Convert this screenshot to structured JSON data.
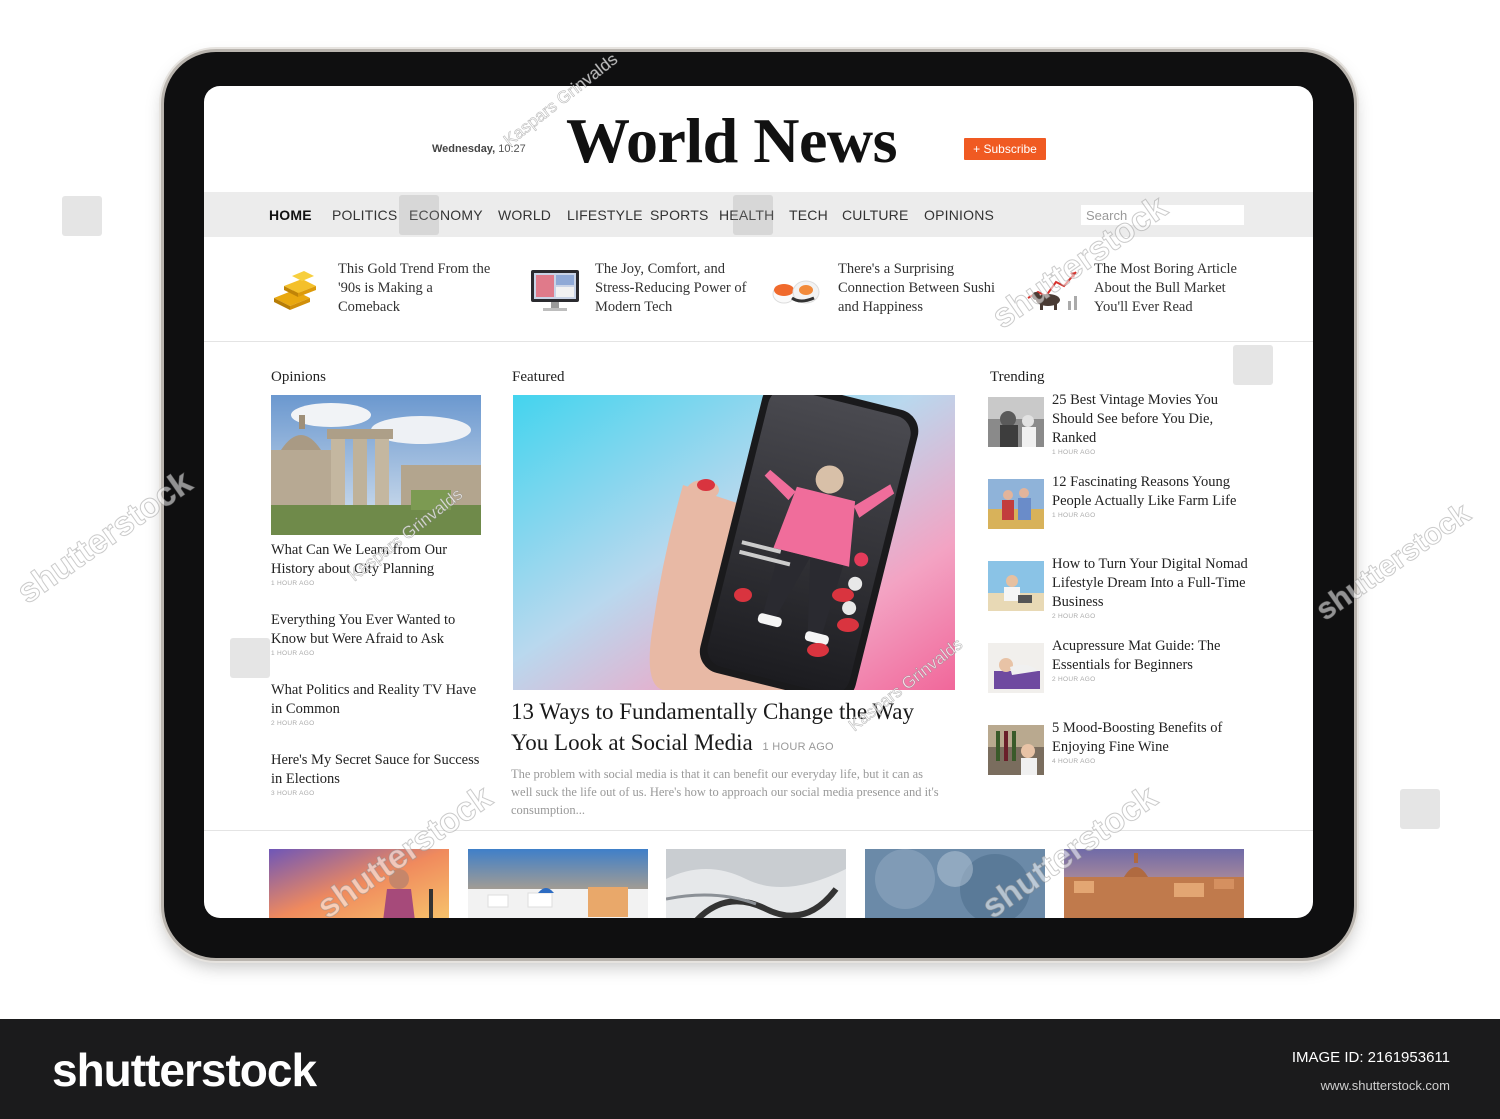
{
  "masthead": {
    "day": "Wednesday,",
    "time": "10:27",
    "logo": "World News",
    "subscribe_label": "+ Subscribe"
  },
  "nav": {
    "items": [
      "HOME",
      "POLITICS",
      "ECONOMY",
      "WORLD",
      "LIFESTYLE",
      "SPORTS",
      "HEALTH",
      "TECH",
      "CULTURE",
      "OPINIONS"
    ],
    "active": "HOME",
    "search_placeholder": "Search"
  },
  "strip": [
    {
      "title": "This Gold Trend From the '90s is Making a Comeback",
      "icon": "gold-bars"
    },
    {
      "title": "The Joy, Comfort, and Stress-Reducing Power of Modern Tech",
      "icon": "monitor"
    },
    {
      "title": "There's a Surprising Connection Between Sushi and Happiness",
      "icon": "sushi"
    },
    {
      "title": "The Most Boring Article About the Bull Market You'll Ever Read",
      "icon": "bull-chart"
    }
  ],
  "sections": {
    "opinions": "Opinions",
    "featured": "Featured",
    "trending": "Trending"
  },
  "opinions": [
    {
      "title": "What Can We Learn from Our History about City Planning",
      "meta": "1 HOUR AGO"
    },
    {
      "title": "Everything You Ever Wanted to Know but Were Afraid to Ask",
      "meta": "1 HOUR AGO"
    },
    {
      "title": "What Politics and Reality TV Have in Common",
      "meta": "2 HOUR AGO"
    },
    {
      "title": "Here's My Secret Sauce for Success in Elections",
      "meta": "3 HOUR AGO"
    }
  ],
  "featured": {
    "title": "13 Ways to Fundamentally Change the Way You Look at Social Media",
    "time": "1 HOUR AGO",
    "summary": "The problem with social media is that it can benefit our everyday life, but it can as well suck the life out of us. Here's how to approach our social media presence and it's consumption..."
  },
  "trending": [
    {
      "title": "25 Best Vintage Movies You Should See before You Die, Ranked",
      "meta": "1 HOUR AGO"
    },
    {
      "title": "12 Fascinating Reasons Young People Actually Like Farm Life",
      "meta": "1 HOUR AGO"
    },
    {
      "title": "How to Turn Your Digital Nomad Lifestyle Dream Into a Full-Time Business",
      "meta": "2 HOUR AGO"
    },
    {
      "title": "Acupressure Mat Guide: The Essentials for Beginners",
      "meta": "2 HOUR AGO"
    },
    {
      "title": "5 Mood-Boosting Benefits of Enjoying Fine Wine",
      "meta": "4 HOUR AGO"
    }
  ],
  "watermark": {
    "brand": "shutterstock",
    "author": "Kaspars Grinvalds"
  },
  "footer": {
    "logo": "shutterstock",
    "image_id": "IMAGE ID: 2161953611",
    "url": "www.shutterstock.com"
  },
  "colors": {
    "accent": "#f05a22",
    "nav_bg": "#ececec",
    "footer_bg": "#1b1b1c"
  }
}
